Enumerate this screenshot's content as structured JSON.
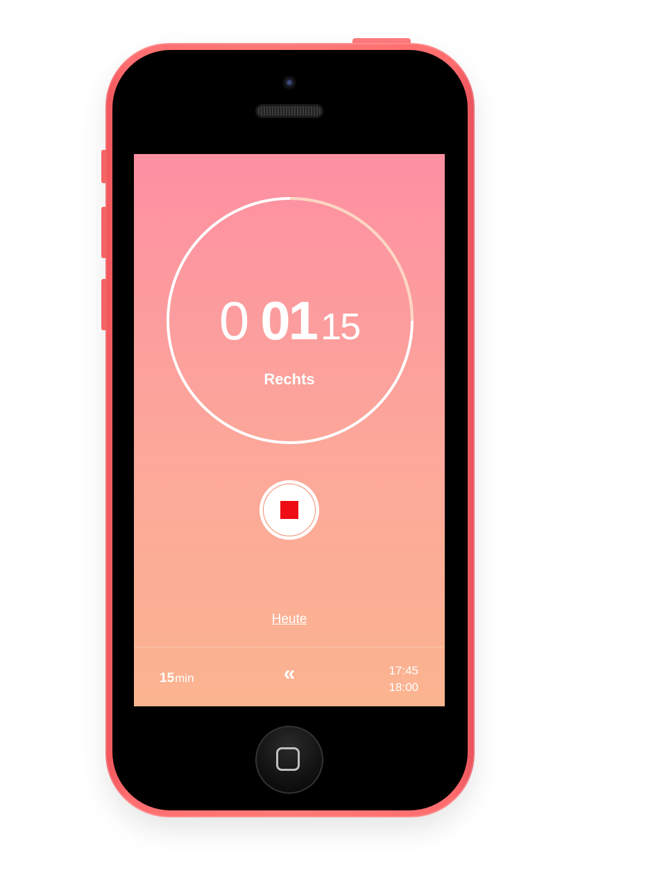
{
  "timer": {
    "hours": "0",
    "minutes": "01",
    "seconds": "15",
    "side_label": "Rechts",
    "progress": 0.25
  },
  "controls": {
    "stop_button": "stop"
  },
  "today_link": "Heute",
  "bottom_bar": {
    "duration_value": "15",
    "duration_unit": "min",
    "back_icon": "double-chevron-left-icon",
    "start_time": "17:45",
    "end_time": "18:00"
  },
  "colors": {
    "phone_body": "#ff7878",
    "screen_top": "#fd8fa2",
    "screen_bottom": "#fbb490",
    "ring": "#ffffff",
    "progress_arc": "#fcd6c2",
    "stop_square": "#ee0d14"
  }
}
